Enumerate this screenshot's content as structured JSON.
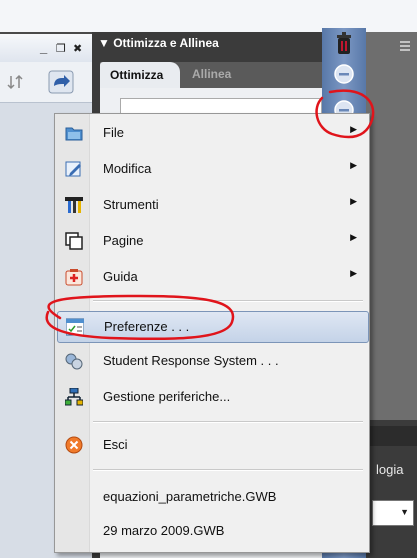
{
  "window_controls": {
    "minimize": "_",
    "restore": "❐",
    "close": "✖"
  },
  "panel": {
    "title": "Ottimizza e Allinea",
    "tabs": [
      {
        "label": "Ottimizza"
      },
      {
        "label": "Allinea"
      }
    ]
  },
  "context_menu": {
    "items": [
      {
        "label": "File",
        "icon": "folder-icon",
        "submenu": true
      },
      {
        "label": "Modifica",
        "icon": "edit-icon",
        "submenu": true
      },
      {
        "label": "Strumenti",
        "icon": "tools-icon",
        "submenu": true
      },
      {
        "label": "Pagine",
        "icon": "pages-icon",
        "submenu": true
      },
      {
        "label": "Guida",
        "icon": "help-icon",
        "submenu": true
      },
      {
        "label": "Preferenze . . .",
        "icon": "preferences-icon",
        "highlighted": true
      },
      {
        "label": "Student Response System . . .",
        "icon": "student-response-icon"
      },
      {
        "label": "Gestione periferiche...",
        "icon": "device-manager-icon"
      },
      {
        "label": "Esci",
        "icon": "exit-icon"
      },
      {
        "label": "equazioni_parametriche.GWB",
        "icon": ""
      },
      {
        "label": "29 marzo 2009.GWB",
        "icon": ""
      }
    ],
    "submenu_arrow": "▶"
  },
  "right_panel": {
    "label": "logia"
  },
  "colors": {
    "annotation_red": "#e0141b",
    "menu_highlight": "#c4d3e8",
    "toolbar_blue": "#6a88b8"
  }
}
